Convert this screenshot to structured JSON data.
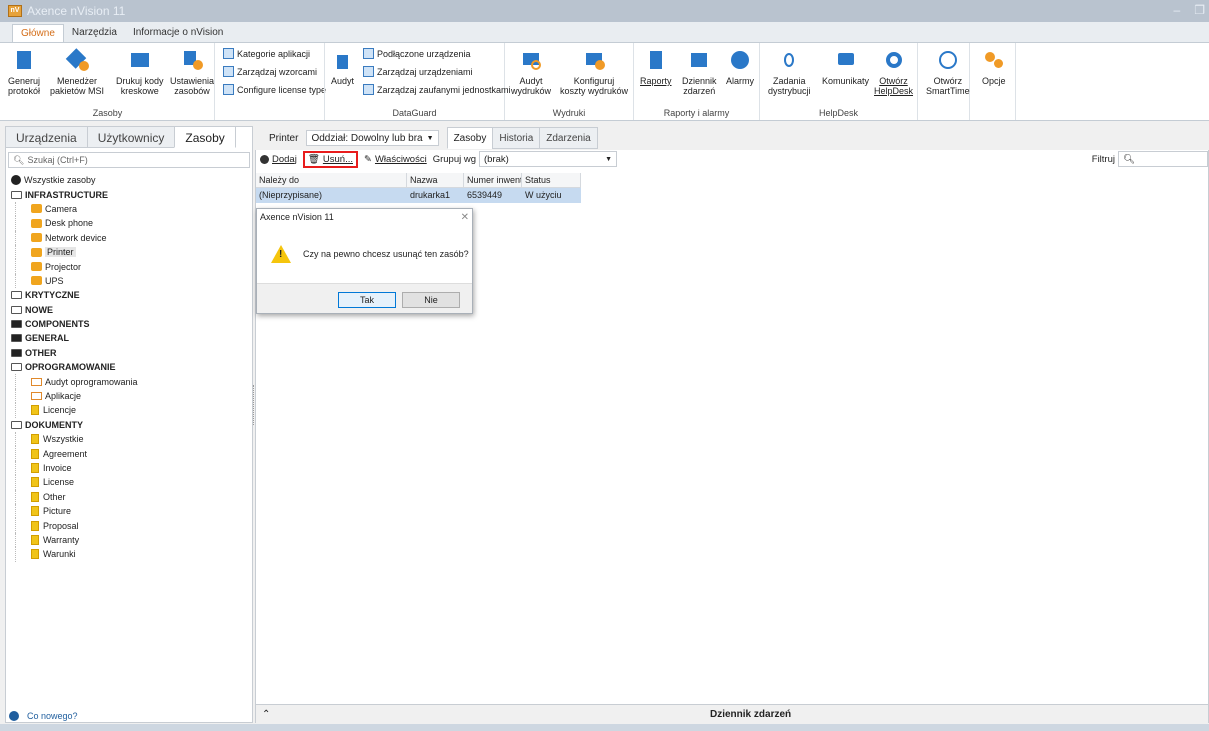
{
  "window": {
    "title": "Axence nVision 11",
    "logo_text": "nV"
  },
  "ribbon_tabs": [
    {
      "label": "Główne",
      "active": true
    },
    {
      "label": "Narzędzia",
      "active": false
    },
    {
      "label": "Informacje o nVision",
      "active": false
    }
  ],
  "ribbon": {
    "groups": {
      "zasoby": "Zasoby",
      "dataguard": "DataGuard",
      "wydruki": "Wydruki",
      "raporty": "Raporty i alarmy",
      "helpdesk": "HelpDesk"
    },
    "buttons": {
      "generuj_protokol": "Generuj\nprotokół",
      "menedzer_msi": "Menedżer\npakietów MSI",
      "drukuj_kody": "Drukuj kody\nkreskowe",
      "ustawienia_zasobow": "Ustawienia\nzasobów",
      "kategorie": "Kategorie aplikacji",
      "wzorce": "Zarządzaj wzorcami",
      "license": "Configure license type",
      "audyt": "Audyt",
      "podlaczone": "Podłączone urządzenia",
      "zarzadzaj_urz": "Zarządzaj urządzeniami",
      "zaufane": "Zarządzaj zaufanymi jednostkami",
      "audyt_wydrukow": "Audyt\nwydruków",
      "koszty": "Konfiguruj\nkoszty wydruków",
      "raporty": "Raporty",
      "dziennik": "Dziennik\nzdarzeń",
      "alarmy": "Alarmy",
      "zadania": "Zadania\ndystrybucji",
      "komunikaty": "Komunikaty",
      "otworz_helpdesk": "Otwórz\nHelpDesk",
      "otworz_smarttime": "Otwórz\nSmartTime",
      "opcje": "Opcje"
    }
  },
  "left_tabs": [
    {
      "label": "Urządzenia",
      "active": false
    },
    {
      "label": "Użytkownicy",
      "active": false
    },
    {
      "label": "Zasoby",
      "active": true
    }
  ],
  "search_placeholder": "Szukaj (Ctrl+F)",
  "tree": [
    {
      "label": "Wszystkie zasoby",
      "type": "globe"
    },
    {
      "label": "INFRASTRUCTURE",
      "type": "root-open"
    },
    {
      "label": "Camera",
      "type": "dev"
    },
    {
      "label": "Desk phone",
      "type": "dev"
    },
    {
      "label": "Network device",
      "type": "dev"
    },
    {
      "label": "Printer",
      "type": "dev",
      "selected": true
    },
    {
      "label": "Projector",
      "type": "dev"
    },
    {
      "label": "UPS",
      "type": "dev"
    },
    {
      "label": "KRYTYCZNE",
      "type": "root-open"
    },
    {
      "label": "NOWE",
      "type": "root-open"
    },
    {
      "label": "COMPONENTS",
      "type": "root-filled"
    },
    {
      "label": "GENERAL",
      "type": "root-filled"
    },
    {
      "label": "OTHER",
      "type": "root-filled"
    },
    {
      "label": "OPROGRAMOWANIE",
      "type": "root-open"
    },
    {
      "label": "Audyt oprogramowania",
      "type": "app"
    },
    {
      "label": "Aplikacje",
      "type": "app"
    },
    {
      "label": "Licencje",
      "type": "doc"
    },
    {
      "label": "DOKUMENTY",
      "type": "root-open"
    },
    {
      "label": "Wszystkie",
      "type": "doc"
    },
    {
      "label": "Agreement",
      "type": "doc"
    },
    {
      "label": "Invoice",
      "type": "doc"
    },
    {
      "label": "License",
      "type": "doc"
    },
    {
      "label": "Other",
      "type": "doc"
    },
    {
      "label": "Picture",
      "type": "doc"
    },
    {
      "label": "Proposal",
      "type": "doc"
    },
    {
      "label": "Warranty",
      "type": "doc"
    },
    {
      "label": "Warunki",
      "type": "doc"
    }
  ],
  "co_nowego": "Co nowego?",
  "content": {
    "crumb": "Printer",
    "oddzial": "Oddział: Dowolny lub bra",
    "tabs": [
      {
        "label": "Zasoby",
        "active": true
      },
      {
        "label": "Historia",
        "active": false
      },
      {
        "label": "Zdarzenia",
        "active": false
      }
    ],
    "toolbar": {
      "dodaj": "Dodaj",
      "usun": "Usuń...",
      "wlasciwosci": "Właściwości",
      "grupuj": "Grupuj wg",
      "grupuj_value": "(brak)",
      "filtruj": "Filtruj"
    },
    "grid": {
      "headers": [
        "Należy do",
        "Nazwa",
        "Numer inwenta",
        "Status"
      ],
      "rows": [
        [
          "(Nieprzypisane)",
          "drukarka1",
          "6539449",
          "W użyciu"
        ]
      ]
    }
  },
  "dialog": {
    "title": "Axence nVision 11",
    "message": "Czy na pewno chcesz usunąć ten zasób?",
    "ok": "Tak",
    "cancel": "Nie"
  },
  "bottom_panel": {
    "title": "Dziennik zdarzeń"
  }
}
